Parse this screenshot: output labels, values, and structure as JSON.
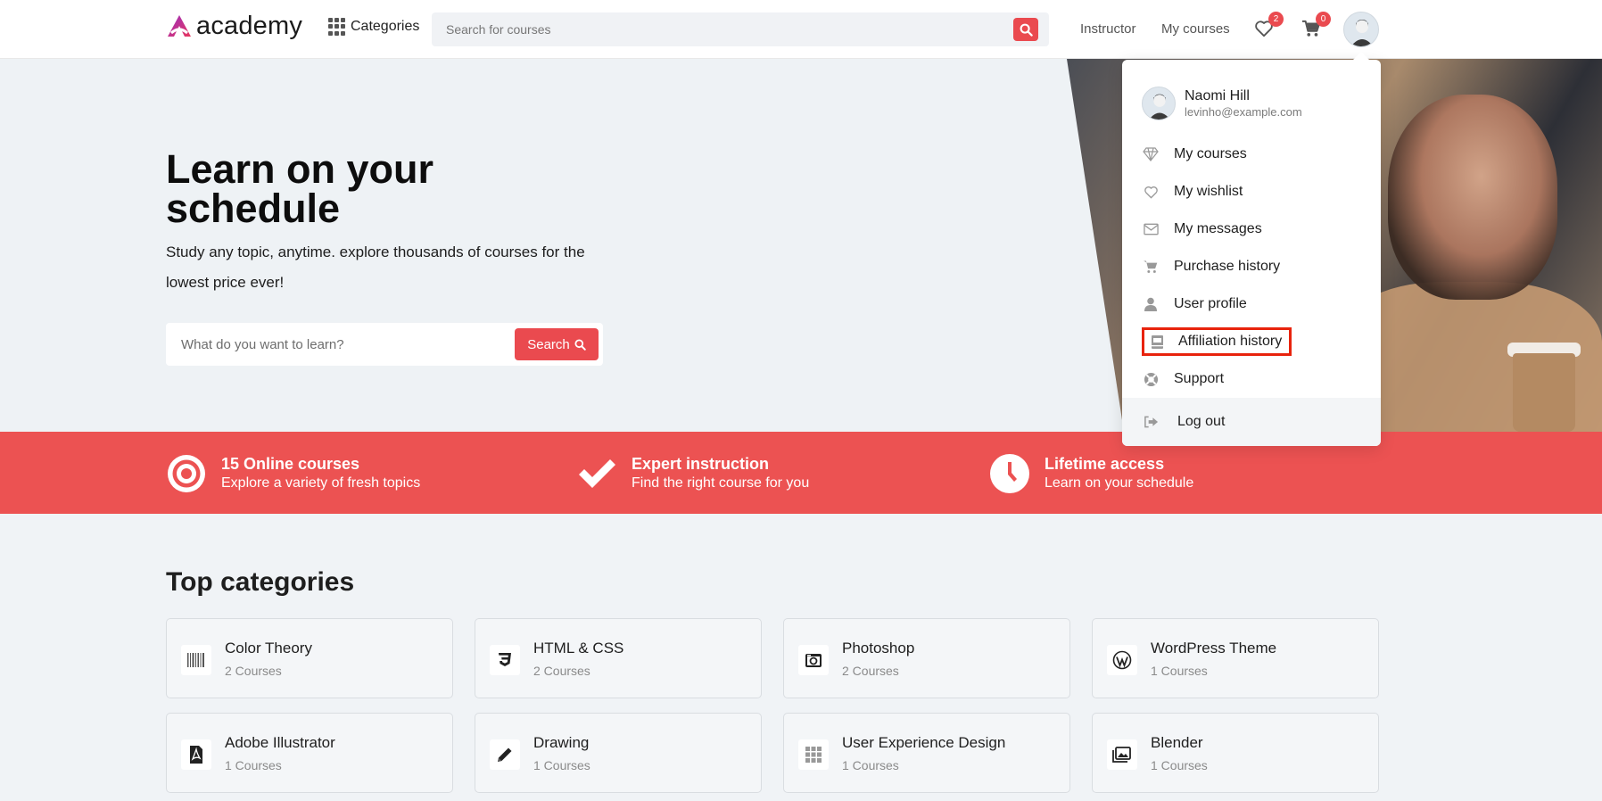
{
  "header": {
    "logo_text": "academy",
    "categories_label": "Categories",
    "search_placeholder": "Search for courses",
    "instructor_label": "Instructor",
    "my_courses_label": "My courses",
    "wishlist_count": "2",
    "cart_count": "0"
  },
  "hero": {
    "title": "Learn on your schedule",
    "subtitle": "Study any topic, anytime. explore thousands of courses for the lowest price ever!",
    "search_placeholder": "What do you want to learn?",
    "search_button": "Search"
  },
  "features": [
    {
      "title": "15 Online courses",
      "desc": "Explore a variety of fresh topics",
      "icon": "target-icon"
    },
    {
      "title": "Expert instruction",
      "desc": "Find the right course for you",
      "icon": "check-icon"
    },
    {
      "title": "Lifetime access",
      "desc": "Learn on your schedule",
      "icon": "clock-icon"
    }
  ],
  "categories": {
    "title": "Top categories",
    "items": [
      {
        "name": "Color Theory",
        "count": "2 Courses",
        "icon": "barcode-icon"
      },
      {
        "name": "HTML & CSS",
        "count": "2 Courses",
        "icon": "css3-icon"
      },
      {
        "name": "Photoshop",
        "count": "2 Courses",
        "icon": "camera-icon"
      },
      {
        "name": "WordPress Theme",
        "count": "1 Courses",
        "icon": "wordpress-icon"
      },
      {
        "name": "Adobe Illustrator",
        "count": "1 Courses",
        "icon": "pdf-file-icon"
      },
      {
        "name": "Drawing",
        "count": "1 Courses",
        "icon": "pencil-icon"
      },
      {
        "name": "User Experience Design",
        "count": "1 Courses",
        "icon": "grid-icon"
      },
      {
        "name": "Blender",
        "count": "1 Courses",
        "icon": "images-icon"
      }
    ]
  },
  "dropdown": {
    "user_name": "Naomi Hill",
    "user_email": "levinho@example.com",
    "items": [
      {
        "label": "My courses",
        "icon": "gem-icon"
      },
      {
        "label": "My wishlist",
        "icon": "heart-icon"
      },
      {
        "label": "My messages",
        "icon": "envelope-icon"
      },
      {
        "label": "Purchase history",
        "icon": "cart-icon"
      },
      {
        "label": "User profile",
        "icon": "user-icon"
      },
      {
        "label": "Affiliation history",
        "icon": "book-icon"
      },
      {
        "label": "Support",
        "icon": "lifebuoy-icon"
      }
    ],
    "logout_label": "Log out"
  },
  "colors": {
    "accent": "#ea4a4f",
    "band": "#ec5252",
    "highlight_border": "#e8230d"
  }
}
